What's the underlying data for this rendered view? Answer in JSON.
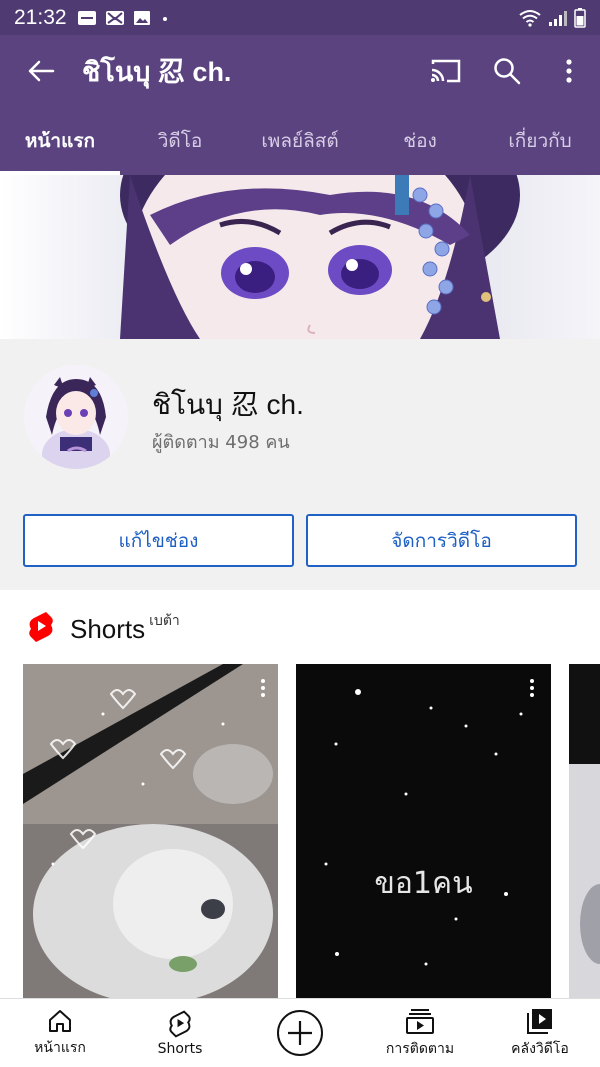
{
  "status_bar": {
    "time": "21:32",
    "icons": [
      "message-icon",
      "mail-icon",
      "image-icon",
      "dot-icon",
      "wifi-icon",
      "signal-icon",
      "battery-icon"
    ]
  },
  "app_bar": {
    "title": "ชิโนบุ 忍 ch.",
    "icons": [
      "back-arrow-icon",
      "cast-icon",
      "search-icon",
      "more-vert-icon"
    ]
  },
  "tabs": [
    {
      "label": "หน้าแรก",
      "active": true
    },
    {
      "label": "วิดีโอ",
      "active": false
    },
    {
      "label": "เพลย์ลิสต์",
      "active": false
    },
    {
      "label": "ช่อง",
      "active": false
    },
    {
      "label": "เกี่ยวกับ",
      "active": false
    }
  ],
  "channel": {
    "name": "ชิโนบุ 忍 ch.",
    "subscribers": "ผู้ติดตาม 498 คน",
    "edit_button": "แก้ไขช่อง",
    "manage_button": "จัดการวิดีโอ"
  },
  "shorts": {
    "title": "Shorts",
    "badge": "เบต้า",
    "items": [
      {
        "caption": ""
      },
      {
        "caption": "ขอ1คน"
      },
      {
        "caption": ""
      }
    ]
  },
  "bottom_nav": [
    {
      "label": "หน้าแรก",
      "icon": "home-icon"
    },
    {
      "label": "Shorts",
      "icon": "shorts-icon"
    },
    {
      "label": "",
      "icon": "create-plus-icon"
    },
    {
      "label": "การติดตาม",
      "icon": "subscriptions-icon"
    },
    {
      "label": "คลังวิดีโอ",
      "icon": "library-icon"
    }
  ],
  "colors": {
    "app_bar": "#5b437f",
    "status_bar": "#4f3b72",
    "accent_blue": "#1d5fc4",
    "shorts_red": "#ff0000"
  }
}
